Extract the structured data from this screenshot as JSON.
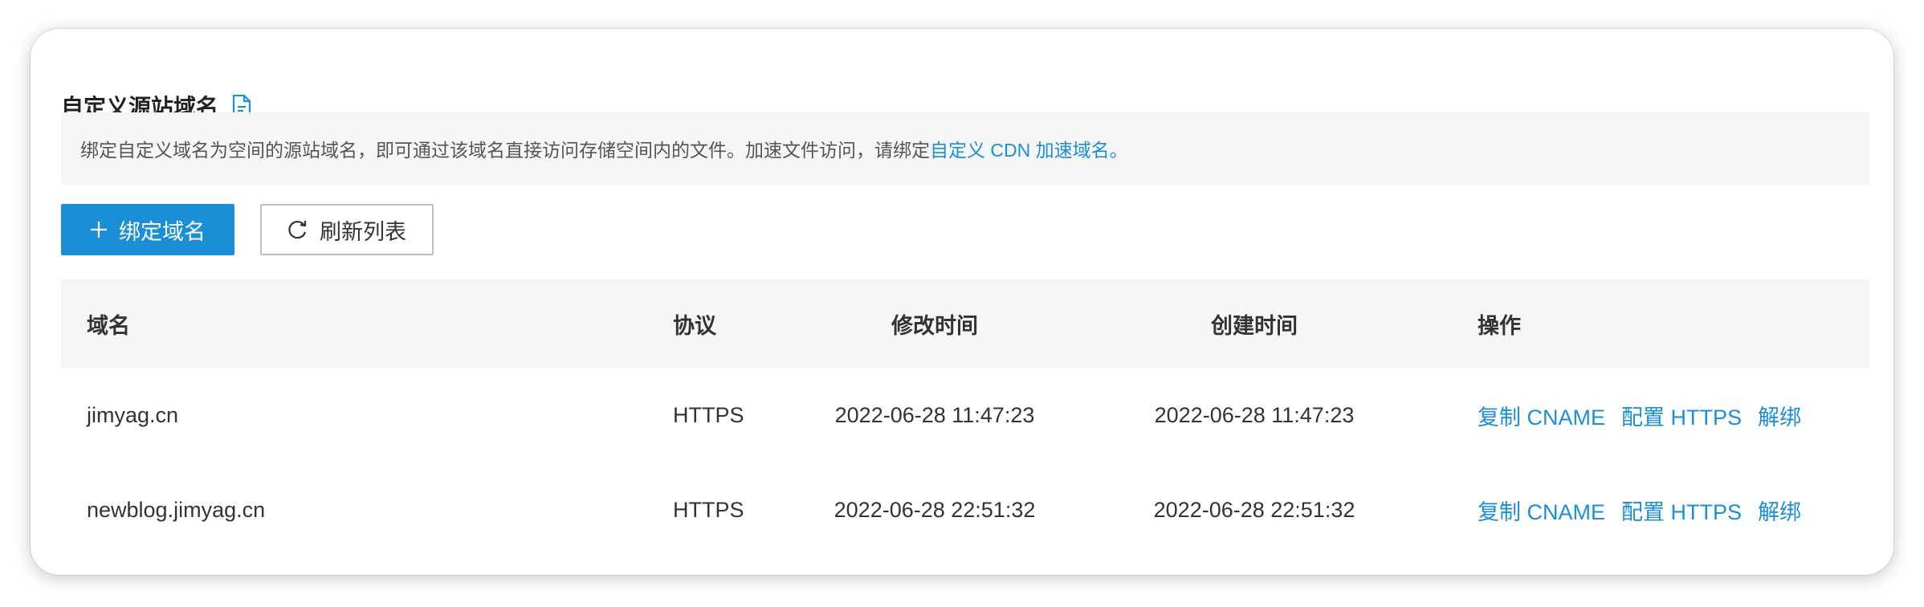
{
  "section": {
    "title": "自定义源站域名",
    "title_icon": "document-icon"
  },
  "notice": {
    "text": "绑定自定义域名为空间的源站域名，即可通过该域名直接访问存储空间内的文件。加速文件访问，请绑定",
    "link_text": "自定义 CDN 加速域名",
    "suffix": "。"
  },
  "toolbar": {
    "bind_label": "绑定域名",
    "bind_icon": "plus-icon",
    "refresh_label": "刷新列表",
    "refresh_icon": "refresh-icon"
  },
  "table": {
    "headers": {
      "domain": "域名",
      "protocol": "协议",
      "modified": "修改时间",
      "created": "创建时间",
      "actions": "操作"
    },
    "rows": [
      {
        "domain": "jimyag.cn",
        "protocol": "HTTPS",
        "modified": "2022-06-28 11:47:23",
        "created": "2022-06-28 11:47:23",
        "actions": [
          "复制 CNAME",
          "配置 HTTPS",
          "解绑"
        ]
      },
      {
        "domain": "newblog.jimyag.cn",
        "protocol": "HTTPS",
        "modified": "2022-06-28 22:51:32",
        "created": "2022-06-28 22:51:32",
        "actions": [
          "复制 CNAME",
          "配置 HTTPS",
          "解绑"
        ]
      }
    ]
  },
  "colors": {
    "accent": "#1a8fd8",
    "header_bg": "#f6f6f6"
  }
}
